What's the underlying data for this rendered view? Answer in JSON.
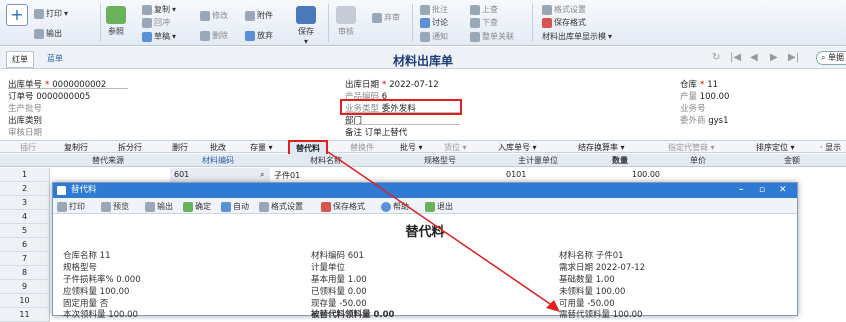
{
  "toolbar": {
    "new_label": "",
    "print": "打印",
    "output": "输出",
    "ref": "参照",
    "copy": "复制",
    "pushback": "回冲",
    "draft": "草稿",
    "modify": "修改",
    "delete": "删除",
    "attach": "附件",
    "discard": "放弃",
    "save": "保存",
    "audit": "审核",
    "abandon": "弃审",
    "approve": "批注",
    "discuss": "讨论",
    "notify": "通知",
    "prev": "上查",
    "next": "下查",
    "linked": "整单关联",
    "fmt_settings": "格式设置",
    "save_fmt": "保存格式",
    "display_template": "材料出库单显示模"
  },
  "titlebar": {
    "tab1": "红单",
    "tab2": "蓝单",
    "doc_title": "材料出库单",
    "search": "单据"
  },
  "header": {
    "outbound_no_label": "出库单号",
    "outbound_no": "0000000002",
    "outbound_date_label": "出库日期",
    "outbound_date": "2022-07-12",
    "warehouse_label": "仓库",
    "warehouse": "11",
    "order_no_label": "订单号",
    "order_no": "0000000005",
    "product_code_label": "产品编码",
    "product_code": "6",
    "output_label": "产量",
    "output": "100.00",
    "batch_label": "生产批号",
    "biz_type_label": "业务类型",
    "biz_type": "委外发料",
    "biz_no_label": "业务号",
    "outbound_cat_label": "出库类别",
    "dept_label": "部门",
    "vendor_label": "委外商",
    "vendor": "gys1",
    "audit_date_label": "审核日期",
    "remark_label": "备注",
    "remark": "订单上替代"
  },
  "grid_toolbar": [
    "插行",
    "复制行",
    "拆分行",
    "删行",
    "批改",
    "存量",
    "替代料",
    "替换件",
    "批号",
    "货位",
    "入库单号",
    "结存换算率",
    "指定代管商",
    "排序定位",
    "显示"
  ],
  "grid_headers": [
    "替代来源",
    "材料编码",
    "材料名称",
    "规格型号",
    "主计量单位",
    "数量",
    "单价",
    "金额"
  ],
  "grid_rows": [
    {
      "num": "1",
      "code": "601",
      "name": "子件01",
      "unit": "0101",
      "qty": "100.00"
    },
    {
      "num": "2"
    },
    {
      "num": "3"
    },
    {
      "num": "4"
    },
    {
      "num": "5"
    },
    {
      "num": "6"
    },
    {
      "num": "7"
    },
    {
      "num": "8"
    },
    {
      "num": "9"
    },
    {
      "num": "10"
    },
    {
      "num": "11"
    }
  ],
  "dialog": {
    "title": "替代料",
    "toolbar": [
      "打印",
      "预览",
      "输出",
      "确定",
      "自动",
      "格式设置",
      "保存格式",
      "帮助",
      "退出"
    ],
    "heading": "替代料",
    "fields": {
      "wh_name_label": "仓库名称",
      "wh_name": "11",
      "mat_code_label": "材料编码",
      "mat_code": "601",
      "mat_name_label": "材料名称",
      "mat_name": "子件01",
      "spec_label": "规格型号",
      "unit_label": "计量单位",
      "demand_date_label": "需求日期",
      "demand_date": "2022-07-12",
      "ratio_label": "子件损耗率%",
      "ratio": "0.000",
      "base_qty_label": "基本用量",
      "base_qty": "1.00",
      "base_count_label": "基础数量",
      "base_count": "1.00",
      "should_label": "应领料量",
      "should": "100.00",
      "issued_label": "已领料量",
      "issued": "0.00",
      "not_issued_label": "未领料量",
      "not_issued": "100.00",
      "fixed_label": "固定用量",
      "fixed": "否",
      "stock_label": "现存量",
      "stock": "-50.00",
      "avail_label": "可用量",
      "avail": "-50.00",
      "this_label": "本次领料量",
      "this": "100.00",
      "sub_label": "被替代料领料量",
      "sub": "0.00",
      "need_sub_label": "需替代领料量",
      "need_sub": "100.00"
    }
  }
}
